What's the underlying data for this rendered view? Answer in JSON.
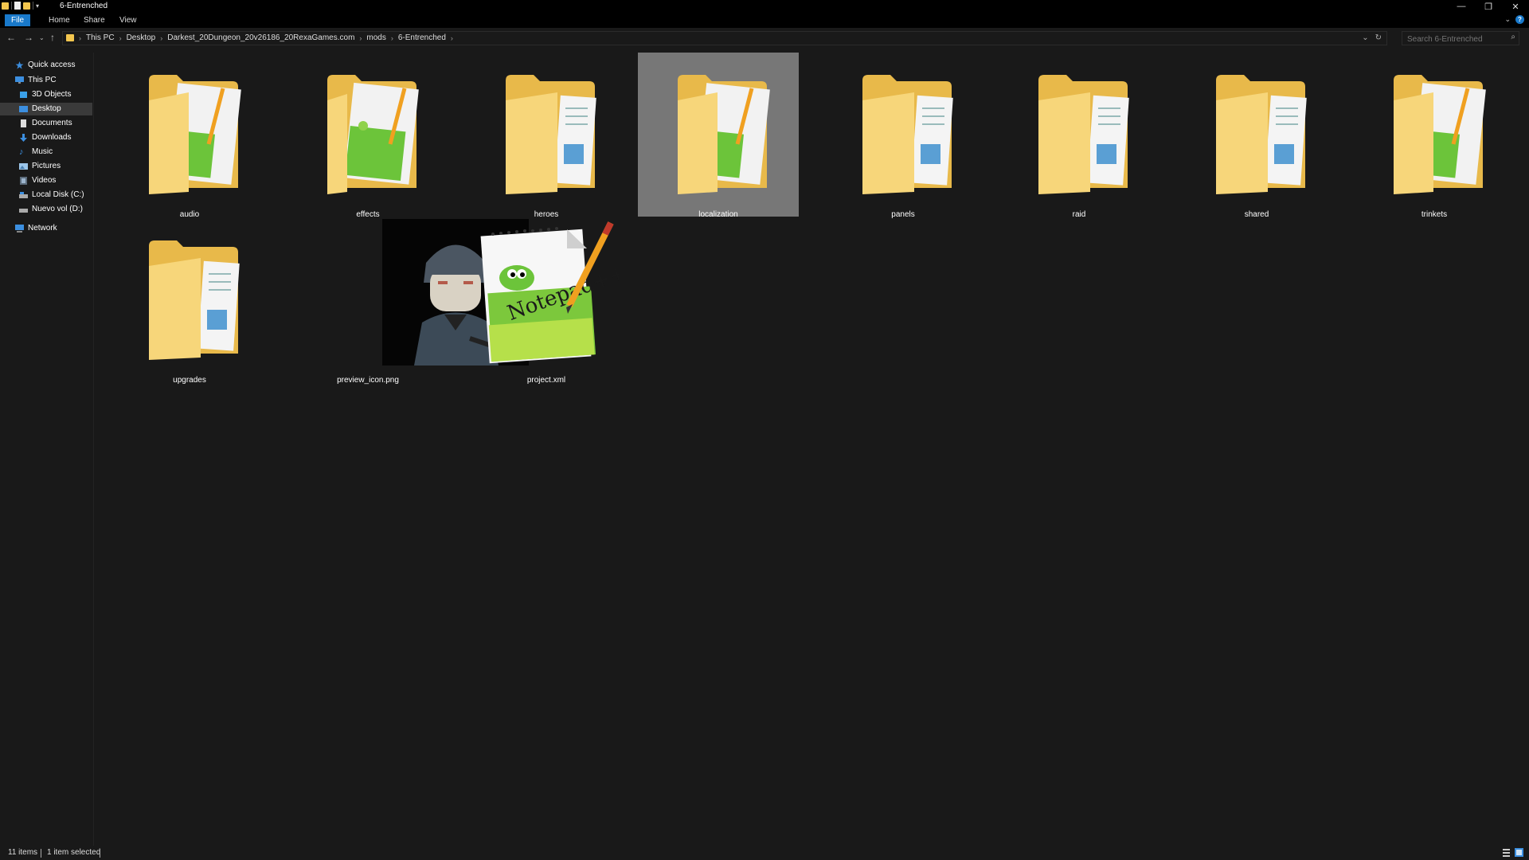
{
  "window": {
    "title": "6-Entrenched",
    "buttons": [
      "minimize",
      "restore",
      "close"
    ]
  },
  "ribbon": {
    "tabs": [
      "File",
      "Home",
      "Share",
      "View"
    ]
  },
  "address": {
    "crumbs": [
      "This PC",
      "Desktop",
      "Darkest_20Dungeon_20v26186_20RexaGames.com",
      "mods",
      "6-Entrenched"
    ]
  },
  "search": {
    "placeholder": "Search 6-Entrenched"
  },
  "nav": {
    "quick_access": "Quick access",
    "this_pc": "This PC",
    "items": [
      "3D Objects",
      "Desktop",
      "Documents",
      "Downloads",
      "Music",
      "Pictures",
      "Videos",
      "Local Disk (C:)",
      "Nuevo vol (D:)"
    ],
    "network": "Network"
  },
  "files": [
    {
      "name": "audio",
      "kind": "folder-notepad"
    },
    {
      "name": "effects",
      "kind": "folder-notepad"
    },
    {
      "name": "heroes",
      "kind": "folder-docs"
    },
    {
      "name": "localization",
      "kind": "folder-notepad",
      "selected": true
    },
    {
      "name": "panels",
      "kind": "folder-docs"
    },
    {
      "name": "raid",
      "kind": "folder-docs"
    },
    {
      "name": "shared",
      "kind": "folder-docs"
    },
    {
      "name": "trinkets",
      "kind": "folder-notepad"
    },
    {
      "name": "upgrades",
      "kind": "folder-docs"
    },
    {
      "name": "preview_icon.png",
      "kind": "image"
    },
    {
      "name": "project.xml",
      "kind": "notepad-file"
    }
  ],
  "status": {
    "count": "11 items",
    "selection": "1 item selected"
  },
  "colors": {
    "background": "#191919",
    "titlebar": "#000000",
    "accent": "#1979ca",
    "folder": "#f3c64e",
    "selection": "#777777"
  }
}
